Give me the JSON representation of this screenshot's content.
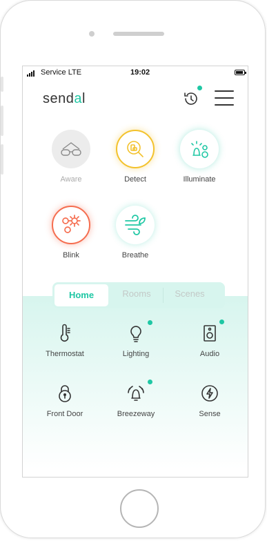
{
  "status_bar": {
    "carrier": "Service  LTE",
    "time": "19:02"
  },
  "header": {
    "logo_prefix": "send",
    "logo_accent": "a",
    "logo_suffix": "l",
    "history_icon": "history-icon",
    "menu_icon": "hamburger-icon"
  },
  "modes": [
    {
      "label": "Aware",
      "icon": "glasses-icon"
    },
    {
      "label": "Detect",
      "icon": "detect-icon"
    },
    {
      "label": "Illuminate",
      "icon": "illuminate-icon"
    },
    {
      "label": "Blink",
      "icon": "blink-icon"
    },
    {
      "label": "Breathe",
      "icon": "breathe-icon"
    }
  ],
  "tabs": [
    {
      "label": "Home",
      "active": true
    },
    {
      "label": "Rooms"
    },
    {
      "label": "Scenes"
    }
  ],
  "devices": [
    {
      "label": "Thermostat",
      "icon": "thermometer-icon",
      "badge": false
    },
    {
      "label": "Lighting",
      "icon": "lightbulb-icon",
      "badge": true
    },
    {
      "label": "Audio",
      "icon": "speaker-icon",
      "badge": true
    },
    {
      "label": "Front Door",
      "icon": "lock-icon",
      "badge": false
    },
    {
      "label": "Breezeway",
      "icon": "alarm-bell-icon",
      "badge": true
    },
    {
      "label": "Sense",
      "icon": "lightning-icon",
      "badge": false
    }
  ],
  "pagination": {
    "pages": 2,
    "current": 1
  },
  "colors": {
    "accent": "#1fc7a4",
    "detect": "#f3c22c",
    "blink": "#f56d4f",
    "panel": "#d7f5ee"
  }
}
